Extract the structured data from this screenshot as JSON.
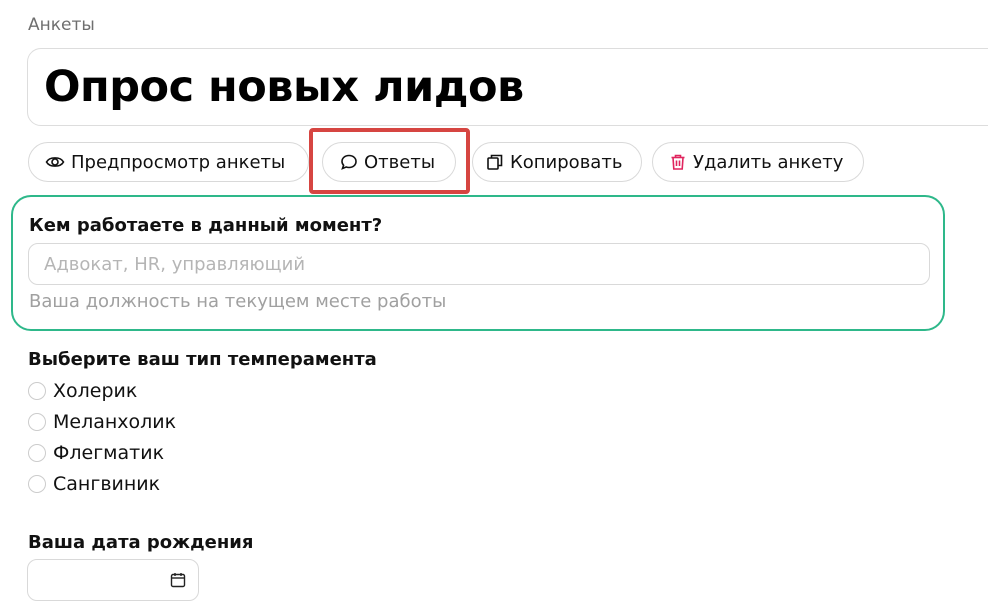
{
  "breadcrumb": "Анкеты",
  "title": "Опрос новых лидов",
  "actions": {
    "preview_label": "Предпросмотр анкеты",
    "answers_label": "Ответы",
    "copy_label": "Копировать",
    "delete_label": "Удалить анкету"
  },
  "question1": {
    "label": "Кем работаете в данный момент?",
    "placeholder": "Адвокат, HR, управляющий",
    "value": "",
    "help": "Ваша должность на текущем месте работы"
  },
  "question2": {
    "label": "Выберите ваш тип темперамента",
    "options": [
      "Холерик",
      "Меланхолик",
      "Флегматик",
      "Сангвиник"
    ],
    "selected": null
  },
  "question3": {
    "label": "Ваша дата рождения",
    "value": ""
  },
  "colors": {
    "active_border": "#2eb88a",
    "highlight": "#d64541",
    "delete_icon": "#e0245e"
  },
  "icons": {
    "preview": "eye-icon",
    "answers": "chat-bubble-icon",
    "copy": "copy-icon",
    "delete": "trash-icon",
    "date": "calendar-icon"
  }
}
